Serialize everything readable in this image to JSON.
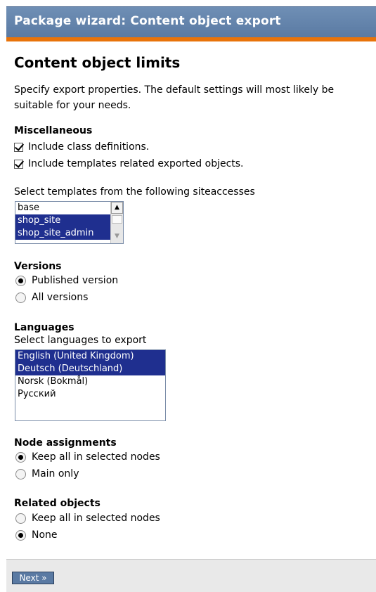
{
  "header": {
    "title": "Package wizard: Content object export"
  },
  "main": {
    "heading": "Content object limits",
    "description": "Specify export properties. The default settings will most likely be suitable for your needs."
  },
  "misc": {
    "heading": "Miscellaneous",
    "include_class_definitions": {
      "label": "Include class definitions.",
      "checked": true
    },
    "include_templates": {
      "label": "Include templates related exported objects.",
      "checked": true
    }
  },
  "siteaccesses": {
    "label": "Select templates from the following siteaccesses",
    "options": [
      {
        "label": "base",
        "selected": false
      },
      {
        "label": "shop_site",
        "selected": true
      },
      {
        "label": "shop_site_admin",
        "selected": true
      }
    ]
  },
  "versions": {
    "heading": "Versions",
    "options": [
      {
        "label": "Published version",
        "selected": true
      },
      {
        "label": "All versions",
        "selected": false
      }
    ]
  },
  "languages": {
    "heading": "Languages",
    "label": "Select languages to export",
    "options": [
      {
        "label": "English (United Kingdom)",
        "selected": true
      },
      {
        "label": "Deutsch (Deutschland)",
        "selected": true
      },
      {
        "label": "Norsk (Bokmål)",
        "selected": false
      },
      {
        "label": "Русский",
        "selected": false
      }
    ]
  },
  "node_assignments": {
    "heading": "Node assignments",
    "options": [
      {
        "label": "Keep all in selected nodes",
        "selected": true
      },
      {
        "label": "Main only",
        "selected": false
      }
    ]
  },
  "related_objects": {
    "heading": "Related objects",
    "options": [
      {
        "label": "Keep all in selected nodes",
        "selected": false
      },
      {
        "label": "None",
        "selected": true
      }
    ]
  },
  "footer": {
    "next_label": "Next »"
  },
  "colors": {
    "header": "#5a7aa3",
    "accent": "#e8730a",
    "selection": "#1f2f8f"
  }
}
